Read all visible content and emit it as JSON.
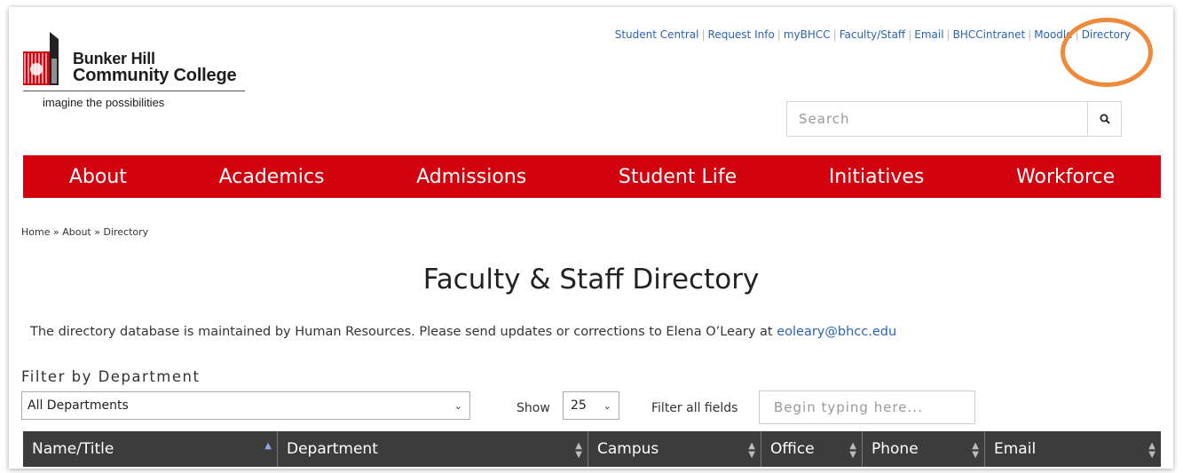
{
  "logo": {
    "name_line1": "Bunker Hill",
    "name_line2": "Community College",
    "tagline": "imagine the possibilities"
  },
  "utility_links": [
    "Student Central",
    "Request Info",
    "myBHCC",
    "Faculty/Staff",
    "Email",
    "BHCCintranet",
    "Moodle",
    "Directory"
  ],
  "search": {
    "placeholder": "Search",
    "icon": "search-icon"
  },
  "nav": [
    "About",
    "Academics",
    "Admissions",
    "Student Life",
    "Initiatives",
    "Workforce"
  ],
  "breadcrumb": "Home » About » Directory",
  "page_title": "Faculty & Staff Directory",
  "note": {
    "text": "The directory database is maintained by Human Resources. Please send updates or corrections to Elena O’Leary at",
    "email": "eoleary@bhcc.edu"
  },
  "filter": {
    "label": "Filter by Department",
    "department_selected": "All Departments",
    "show_label": "Show",
    "show_selected": "25",
    "filter_all_label": "Filter all fields",
    "filter_all_placeholder": "Begin typing here..."
  },
  "table": {
    "columns": [
      "Name/Title",
      "Department",
      "Campus",
      "Office",
      "Phone",
      "Email"
    ]
  },
  "colors": {
    "brand_red": "#d3020f",
    "link_blue": "#2a63b4",
    "header_dark": "#3c3c3c",
    "highlight": "#ee8a3a"
  }
}
